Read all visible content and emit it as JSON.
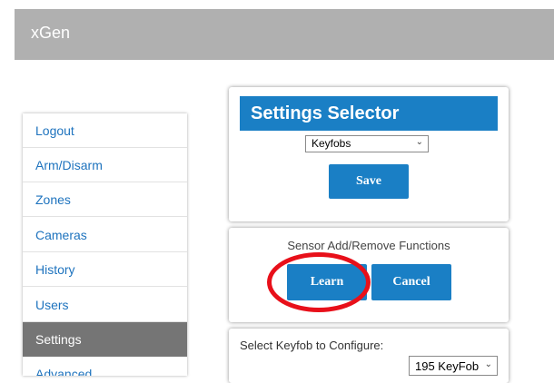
{
  "app": {
    "title": "xGen"
  },
  "sidebar": {
    "items": [
      {
        "label": "Logout",
        "active": false
      },
      {
        "label": "Arm/Disarm",
        "active": false
      },
      {
        "label": "Zones",
        "active": false
      },
      {
        "label": "Cameras",
        "active": false
      },
      {
        "label": "History",
        "active": false
      },
      {
        "label": "Users",
        "active": false
      },
      {
        "label": "Settings",
        "active": true
      },
      {
        "label": "Advanced",
        "active": false
      }
    ]
  },
  "settings_selector": {
    "title": "Settings Selector",
    "selected_value": "Keyfobs",
    "save_label": "Save"
  },
  "sensor_panel": {
    "title": "Sensor Add/Remove Functions",
    "learn_label": "Learn",
    "cancel_label": "Cancel"
  },
  "keyfob_panel": {
    "label": "Select Keyfob to Configure:",
    "selected_value": "195 KeyFob"
  },
  "annotation": {
    "circle_color": "#e8101a"
  },
  "colors": {
    "accent": "#1a7fc5",
    "active_nav": "#757575",
    "header": "#b0b0b0"
  }
}
